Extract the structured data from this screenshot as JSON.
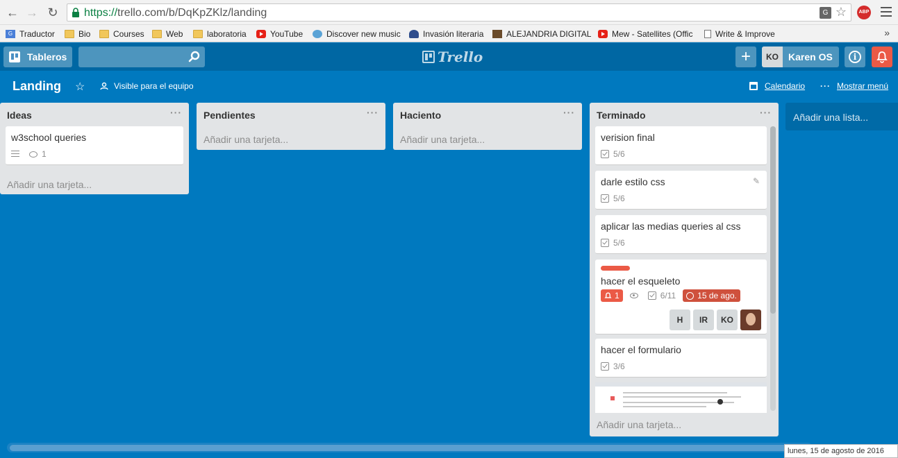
{
  "browser": {
    "url_scheme": "https://",
    "url_rest": "trello.com/b/DqKpZKlz/landing",
    "abp_label": "ABP",
    "bookmarks": [
      {
        "label": "Traductor",
        "icon": "translate-icon"
      },
      {
        "label": "Bio",
        "icon": "folder-icon"
      },
      {
        "label": "Courses",
        "icon": "folder-icon"
      },
      {
        "label": "Web",
        "icon": "folder-icon"
      },
      {
        "label": "laboratoria",
        "icon": "folder-icon"
      },
      {
        "label": "YouTube",
        "icon": "youtube-icon"
      },
      {
        "label": "Discover new music",
        "icon": "music-icon"
      },
      {
        "label": "Invasión literaria",
        "icon": "person-icon"
      },
      {
        "label": "ALEJANDRIA DIGITAL",
        "icon": "image-icon"
      },
      {
        "label": "Mew - Satellites (Offic",
        "icon": "youtube-icon"
      },
      {
        "label": "Write & Improve",
        "icon": "document-icon"
      }
    ],
    "more": "»"
  },
  "header": {
    "boards_label": "Tableros",
    "search_value": "",
    "logo_text": "Trello",
    "user_initials": "KO",
    "user_name": "Karen OS"
  },
  "board": {
    "title": "Landing",
    "visibility": "Visible para el equipo",
    "calendar": "Calendario",
    "show_menu": "Mostrar menú"
  },
  "lists": [
    {
      "name": "Ideas",
      "add_card": "Añadir una tarjeta...",
      "cards": [
        {
          "title": "w3school queries",
          "comments": "1"
        }
      ]
    },
    {
      "name": "Pendientes",
      "add_card": "Añadir una tarjeta..."
    },
    {
      "name": "Haciento",
      "add_card": "Añadir una tarjeta..."
    },
    {
      "name": "Terminado",
      "add_card": "Añadir una tarjeta...",
      "cards": [
        {
          "title": "verision final",
          "checklist": "5/6"
        },
        {
          "title": "darle estilo css",
          "checklist": "5/6"
        },
        {
          "title": "aplicar las medias queries al css",
          "checklist": "5/6"
        },
        {
          "title": "hacer el esqueleto",
          "label_color": "#eb5a46",
          "notifications": "1",
          "checklist": "6/11",
          "due": "15 de ago.",
          "members": [
            "H",
            "IR",
            "KO"
          ]
        },
        {
          "title": "hacer el formulario",
          "checklist": "3/6"
        }
      ]
    }
  ],
  "add_list": "Añadir una lista...",
  "taskbar_date": "lunes, 15 de agosto de 2016",
  "list_menu_glyph": "···"
}
